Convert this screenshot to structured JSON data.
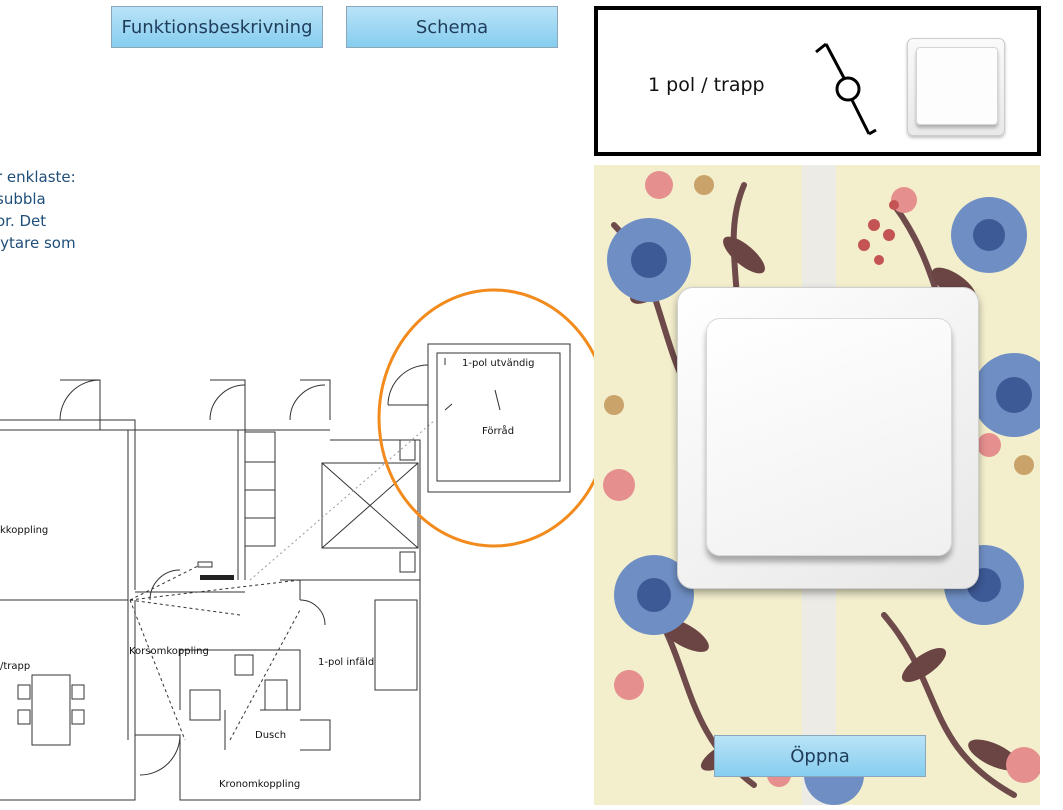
{
  "toolbar": {
    "functions_label": "Funktionsbeskrivning",
    "schema_label": "Schema"
  },
  "description": {
    "lines": [
      "r enklaste:",
      "subbla",
      "or. Det",
      "lytare som"
    ]
  },
  "info_box": {
    "label": "1 pol / trapp",
    "symbol_icon": "two-way-switch-symbol-icon"
  },
  "floor_plan": {
    "labels": {
      "utvandig": "1-pol utvändig",
      "forrad": "Förråd",
      "koppling": "kkoppling",
      "trapp": "/trapp",
      "korsom": "Korsomkoppling",
      "infald": "1-pol infäld",
      "dusch": "Dusch",
      "kronom": "Kronomkoppling"
    },
    "highlight_color": "#f28a1c"
  },
  "preview": {
    "open_label": "Öppna"
  },
  "colors": {
    "button_top": "#b9e3f7",
    "button_bottom": "#86cdef",
    "text_blue": "#1f4e79"
  }
}
